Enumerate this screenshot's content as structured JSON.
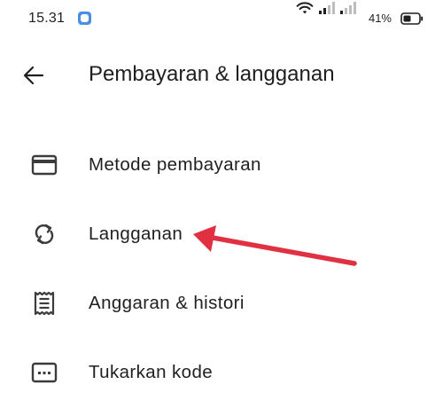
{
  "status_bar": {
    "time": "15.31",
    "battery_percent": "41%",
    "icons": [
      "app-notification-icon",
      "wifi-icon",
      "signal-icon",
      "signal-icon",
      "battery-icon"
    ]
  },
  "header": {
    "back_icon": "arrow-left-icon",
    "title": "Pembayaran & langganan"
  },
  "menu": {
    "items": [
      {
        "icon": "credit-card-icon",
        "label": "Metode pembayaran"
      },
      {
        "icon": "sync-icon",
        "label": "Langganan"
      },
      {
        "icon": "receipt-icon",
        "label": "Anggaran & histori"
      },
      {
        "icon": "redeem-code-icon",
        "label": "Tukarkan kode"
      }
    ]
  },
  "annotation": {
    "color": "#e03042",
    "points_to": "Langganan"
  },
  "colors": {
    "text": "#1f1f1f",
    "icon": "#3c3c3c",
    "accent_arrow": "#e03042",
    "app_icon": "#4a90e2"
  }
}
